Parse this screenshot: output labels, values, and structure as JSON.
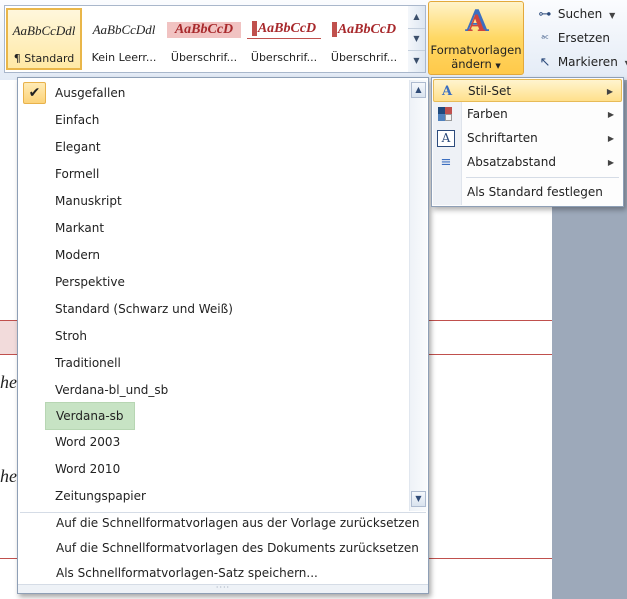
{
  "ribbon": {
    "styles_gallery": [
      {
        "sample": "AaBbCcDdl",
        "label": "¶ Standard",
        "selected": true,
        "kind": "normal"
      },
      {
        "sample": "AaBbCcDdl",
        "label": "Kein Leerr...",
        "selected": false,
        "kind": "normal"
      },
      {
        "sample": "AaBbCcD",
        "label": "Überschrif...",
        "selected": false,
        "kind": "hbg"
      },
      {
        "sample": "AaBbCcD",
        "label": "Überschrif...",
        "selected": false,
        "kind": "hbar"
      },
      {
        "sample": "AaBbCcD",
        "label": "Überschrif...",
        "selected": false,
        "kind": "hbox"
      }
    ],
    "change_styles": {
      "line1": "Formatvorlagen",
      "line2": "ändern",
      "icon": "change-styles-icon"
    },
    "editing": {
      "find_label": "Suchen",
      "replace_label": "Ersetzen",
      "select_label": "Markieren"
    }
  },
  "document": {
    "text_fragments": [
      "he",
      "he"
    ]
  },
  "style_sets": {
    "checked_index": 0,
    "hovered_index": 12,
    "items": [
      "Ausgefallen",
      "Einfach",
      "Elegant",
      "Formell",
      "Manuskript",
      "Markant",
      "Modern",
      "Perspektive",
      "Standard (Schwarz und Weiß)",
      "Stroh",
      "Traditionell",
      "Verdana-bl_und_sb",
      "Verdana-sb",
      "Word 2003",
      "Word 2010",
      "Zeitungspapier"
    ],
    "commands": [
      "Auf die Schnellformatvorlagen aus der Vorlage zurücksetzen",
      "Auf die Schnellformatvorlagen des Dokuments zurücksetzen",
      "Als Schnellformatvorlagen-Satz speichern..."
    ]
  },
  "change_styles_menu": {
    "items": [
      {
        "label": "Stil-Set",
        "icon": "style-set-icon",
        "has_submenu": true,
        "highlighted": true
      },
      {
        "label": "Farben",
        "icon": "colors-icon",
        "has_submenu": true,
        "highlighted": false
      },
      {
        "label": "Schriftarten",
        "icon": "fonts-icon",
        "has_submenu": true,
        "highlighted": false
      },
      {
        "label": "Absatzabstand",
        "icon": "paragraph-spacing-icon",
        "has_submenu": true,
        "highlighted": false
      }
    ],
    "set_default_label": "Als Standard festlegen"
  },
  "colors": {
    "accent_highlight": "#ffe08b",
    "hover_green": "#c7e3c4",
    "heading_red": "#c0504d"
  }
}
